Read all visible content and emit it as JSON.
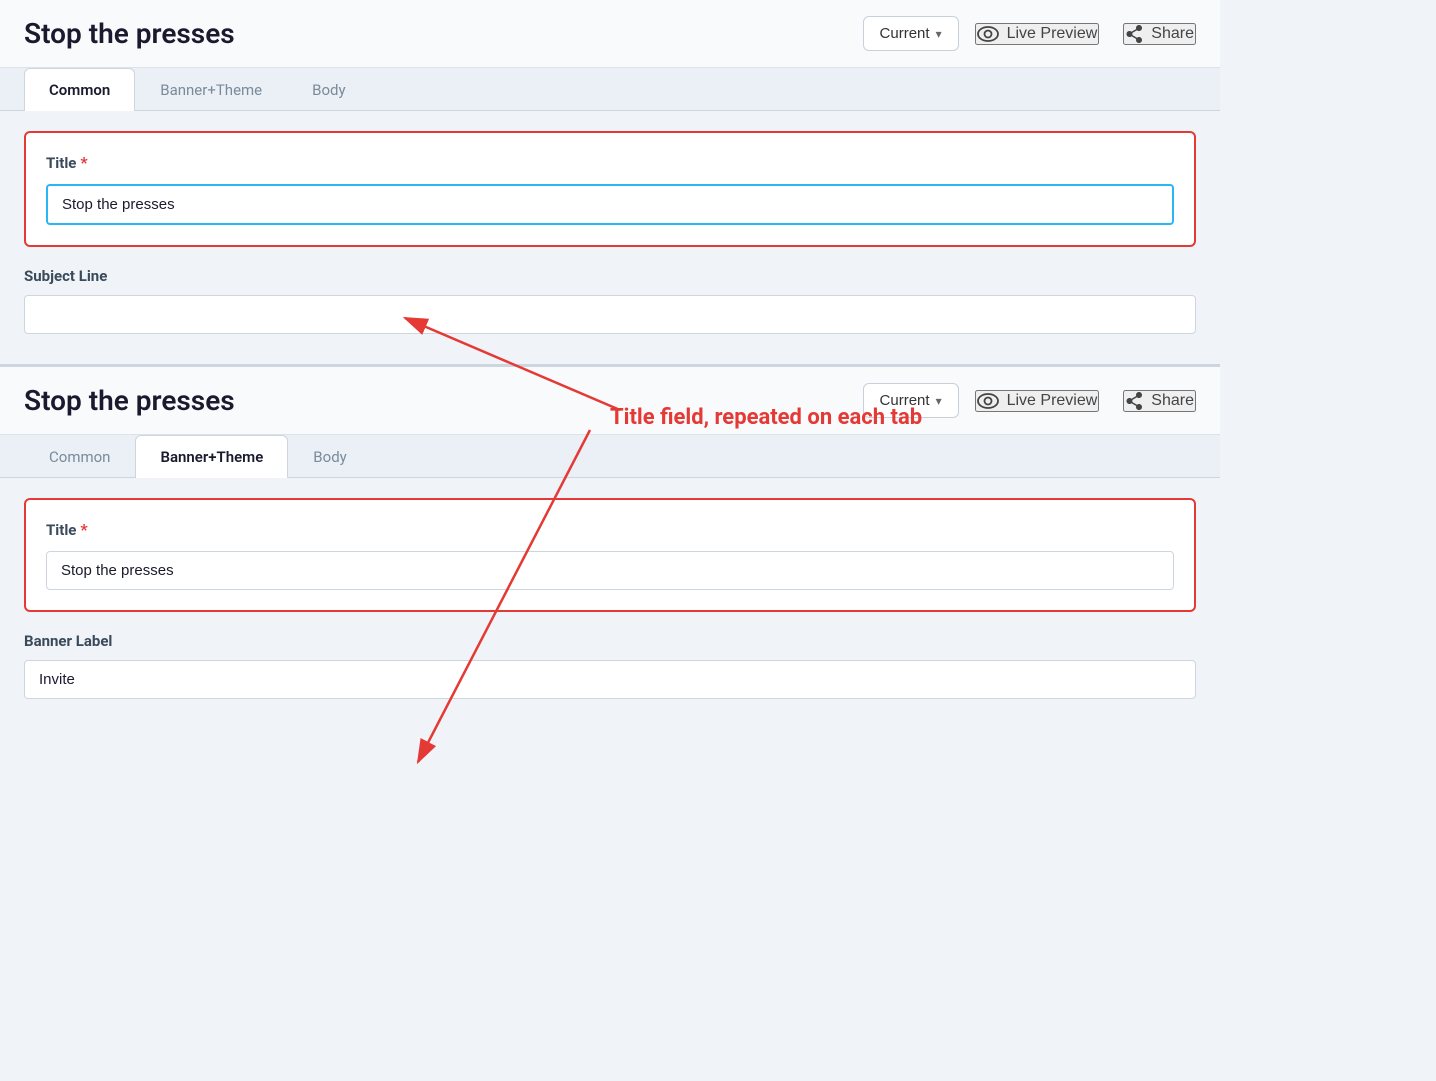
{
  "page": {
    "title": "Stop the presses"
  },
  "panel1": {
    "header": {
      "title": "Stop the presses",
      "current_label": "Current",
      "live_preview_label": "Live Preview",
      "share_label": "Share"
    },
    "tabs": [
      {
        "id": "common",
        "label": "Common",
        "active": true
      },
      {
        "id": "banner-theme",
        "label": "Banner+Theme",
        "active": false
      },
      {
        "id": "body",
        "label": "Body",
        "active": false
      }
    ],
    "title_field": {
      "label": "Title",
      "required": true,
      "value": "Stop the presses"
    },
    "subject_field": {
      "label": "Subject Line",
      "value": ""
    }
  },
  "panel2": {
    "header": {
      "title": "Stop the presses",
      "current_label": "Current",
      "live_preview_label": "Live Preview",
      "share_label": "Share"
    },
    "tabs": [
      {
        "id": "common",
        "label": "Common",
        "active": false
      },
      {
        "id": "banner-theme",
        "label": "Banner+Theme",
        "active": true
      },
      {
        "id": "body",
        "label": "Body",
        "active": false
      }
    ],
    "title_field": {
      "label": "Title",
      "required": true,
      "value": "Stop the presses"
    },
    "banner_label_field": {
      "label": "Banner Label",
      "value": "Invite"
    }
  },
  "annotation": {
    "text": "Title field, repeated on each tab"
  }
}
